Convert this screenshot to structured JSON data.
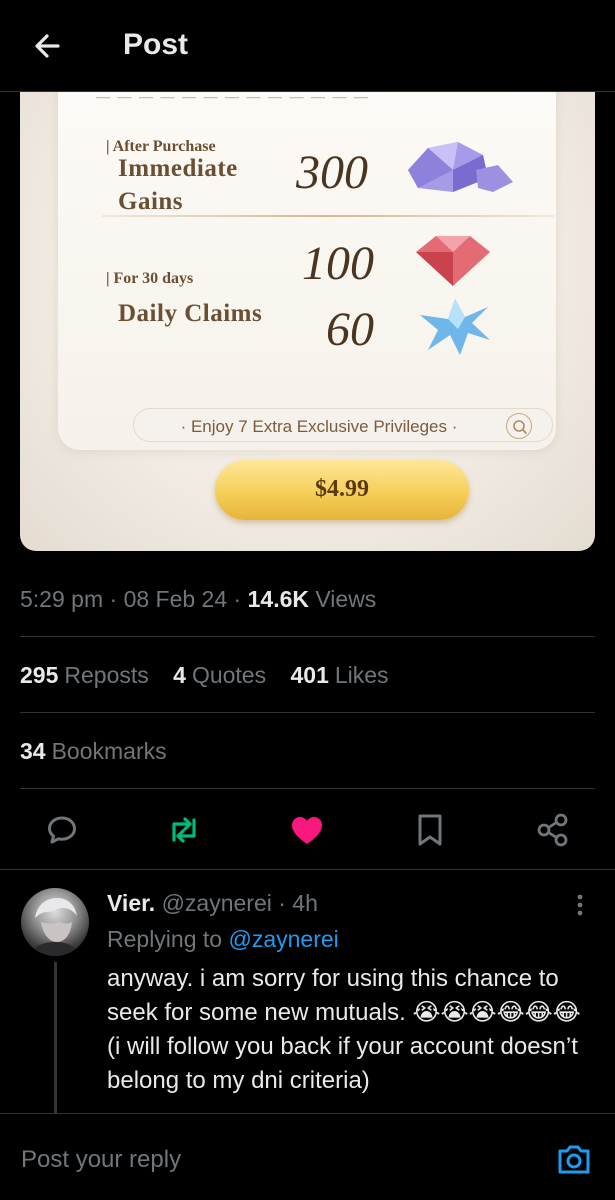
{
  "header": {
    "title": "Post"
  },
  "media": {
    "after_purchase": "After Purchase",
    "immediate": "Immediate",
    "gains": "Gains",
    "immediate_value": "300",
    "for_days": "For 30 days",
    "daily_claims": "Daily Claims",
    "daily_value_1": "100",
    "daily_value_2": "60",
    "privileges": "· Enjoy 7 Extra Exclusive Privileges ·",
    "price": "$4.99"
  },
  "meta": {
    "time": "5:29 pm",
    "date": "08 Feb 24",
    "views_count": "14.6K",
    "views_label": "Views"
  },
  "stats": {
    "reposts_count": "295",
    "reposts_label": "Reposts",
    "quotes_count": "4",
    "quotes_label": "Quotes",
    "likes_count": "401",
    "likes_label": "Likes",
    "bookmarks_count": "34",
    "bookmarks_label": "Bookmarks"
  },
  "colors": {
    "accent": "#1d9bf0",
    "repost": "#00ba7c",
    "like": "#f91880",
    "muted": "#71767b"
  },
  "reply": {
    "name": "Vier.",
    "handle": "@zaynerei · 4h",
    "replying_to": "Replying to",
    "mention": "@zaynerei",
    "text": "anyway. i am sorry for using this chance to seek for some new mutuals. 😭😭😭😂😂😂 (i will follow you back if your account doesn’t belong to my dni criteria)"
  },
  "composer": {
    "placeholder": "Post your reply"
  }
}
